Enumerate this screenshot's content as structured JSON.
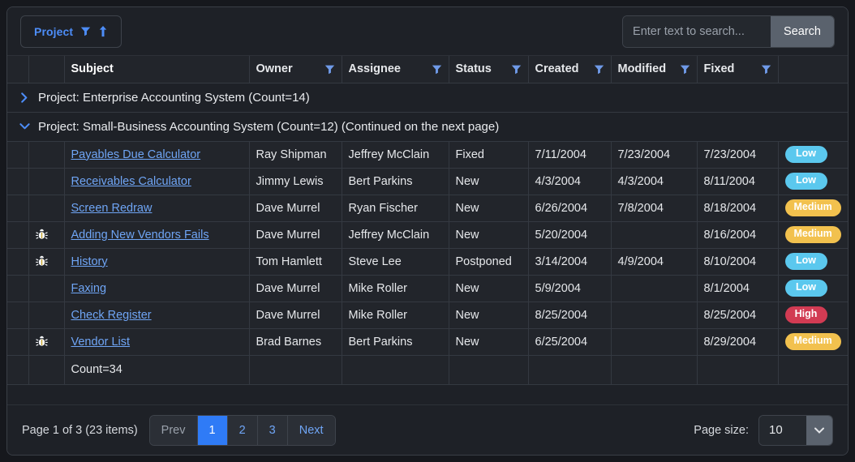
{
  "groupbar": {
    "chip_label": "Project",
    "filter_icon": "funnel-icon",
    "sort_icon": "arrow-up-icon"
  },
  "search": {
    "placeholder": "Enter text to search...",
    "value": "",
    "button_label": "Search"
  },
  "columns": [
    {
      "key": "expand",
      "label": "",
      "filterable": false
    },
    {
      "key": "icon",
      "label": "",
      "filterable": false
    },
    {
      "key": "subject",
      "label": "Subject",
      "filterable": false
    },
    {
      "key": "owner",
      "label": "Owner",
      "filterable": true
    },
    {
      "key": "assignee",
      "label": "Assignee",
      "filterable": true
    },
    {
      "key": "status",
      "label": "Status",
      "filterable": true
    },
    {
      "key": "created",
      "label": "Created",
      "filterable": true
    },
    {
      "key": "modified",
      "label": "Modified",
      "filterable": true
    },
    {
      "key": "fixed",
      "label": "Fixed",
      "filterable": true
    },
    {
      "key": "priority",
      "label": "",
      "filterable": false
    }
  ],
  "headers": {
    "subject": "Subject",
    "owner": "Owner",
    "assignee": "Assignee",
    "status": "Status",
    "created": "Created",
    "modified": "Modified",
    "fixed": "Fixed"
  },
  "groups": [
    {
      "expanded": false,
      "chevron": "chevron-right-icon",
      "label": "Project: Enterprise Accounting System (Count=14)"
    },
    {
      "expanded": true,
      "chevron": "chevron-down-icon",
      "label": "Project: Small-Business Accounting System (Count=12) (Continued on the next page)"
    }
  ],
  "rows": [
    {
      "bug": false,
      "subject": "Payables Due Calculator",
      "owner": "Ray Shipman",
      "assignee": "Jeffrey McClain",
      "status": "Fixed",
      "created": "7/11/2004",
      "modified": "7/23/2004",
      "fixed": "7/23/2004",
      "priority": "Low",
      "priority_class": "low"
    },
    {
      "bug": false,
      "subject": "Receivables Calculator",
      "owner": "Jimmy Lewis",
      "assignee": "Bert Parkins",
      "status": "New",
      "created": "4/3/2004",
      "modified": "4/3/2004",
      "fixed": "8/11/2004",
      "priority": "Low",
      "priority_class": "low"
    },
    {
      "bug": false,
      "subject": "Screen Redraw",
      "owner": "Dave Murrel",
      "assignee": "Ryan Fischer",
      "status": "New",
      "created": "6/26/2004",
      "modified": "7/8/2004",
      "fixed": "8/18/2004",
      "priority": "Medium",
      "priority_class": "medium"
    },
    {
      "bug": true,
      "subject": "Adding New Vendors Fails",
      "owner": "Dave Murrel",
      "assignee": "Jeffrey McClain",
      "status": "New",
      "created": "5/20/2004",
      "modified": "",
      "fixed": "8/16/2004",
      "priority": "Medium",
      "priority_class": "medium"
    },
    {
      "bug": true,
      "subject": "History",
      "owner": "Tom Hamlett",
      "assignee": "Steve Lee",
      "status": "Postponed",
      "created": "3/14/2004",
      "modified": "4/9/2004",
      "fixed": "8/10/2004",
      "priority": "Low",
      "priority_class": "low"
    },
    {
      "bug": false,
      "subject": "Faxing",
      "owner": "Dave Murrel",
      "assignee": "Mike Roller",
      "status": "New",
      "created": "5/9/2004",
      "modified": "",
      "fixed": "8/1/2004",
      "priority": "Low",
      "priority_class": "low"
    },
    {
      "bug": false,
      "subject": "Check Register",
      "owner": "Dave Murrel",
      "assignee": "Mike Roller",
      "status": "New",
      "created": "8/25/2004",
      "modified": "",
      "fixed": "8/25/2004",
      "priority": "High",
      "priority_class": "high"
    },
    {
      "bug": true,
      "subject": "Vendor List",
      "owner": "Brad Barnes",
      "assignee": "Bert Parkins",
      "status": "New",
      "created": "6/25/2004",
      "modified": "",
      "fixed": "8/29/2004",
      "priority": "Medium",
      "priority_class": "medium"
    }
  ],
  "total_row": {
    "label": "Count=34"
  },
  "footer": {
    "page_info": "Page 1 of 3 (23 items)",
    "prev_label": "Prev",
    "next_label": "Next",
    "pages": [
      "1",
      "2",
      "3"
    ],
    "active_page": "1",
    "page_size_label": "Page size:",
    "page_size_value": "10",
    "dropdown_icon": "chevron-down-icon"
  },
  "colors": {
    "accent_blue": "#4d8df8",
    "link_blue": "#6fa5f5",
    "active_page": "#2f7bf6",
    "badge_low": "#5bc8ee",
    "badge_medium": "#f2c14e",
    "badge_high": "#d23b53",
    "panel_bg": "#22252b",
    "app_bg": "#16181d"
  }
}
